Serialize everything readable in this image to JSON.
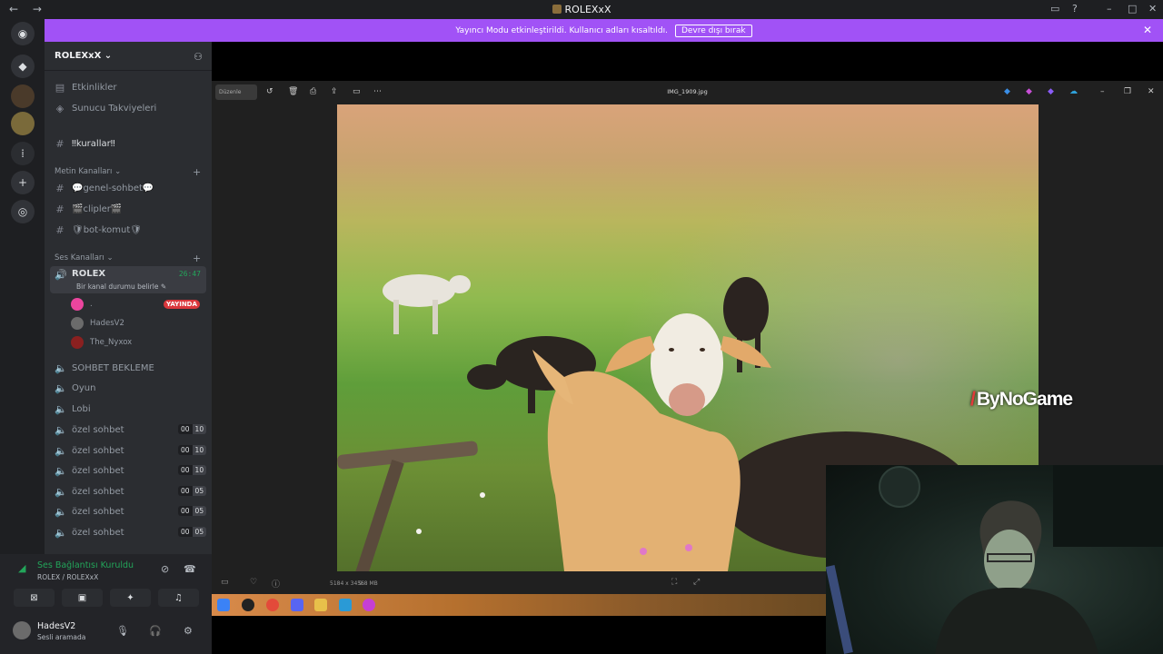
{
  "window": {
    "title": "ROLEXxX",
    "nav": "← →"
  },
  "banner": {
    "text": "Yayıncı Modu etkinleştirildi. Kullanıcı adları kısaltıldı.",
    "button": "Devre dışı bırak",
    "close": "✕"
  },
  "server": {
    "name": "ROLEXxX ⌄"
  },
  "sidebar": {
    "events": "Etkinlikler",
    "boosts": "Sunucu Takviyeleri",
    "rules_channel": "‼kurallar‼",
    "text_category": "Metin Kanalları ⌄",
    "text_channels": [
      "💬genel-sohbet💬",
      "🎬clipler🎬",
      "🛡bot-komut🛡"
    ],
    "voice_category": "Ses Kanalları ⌄",
    "active_voice": {
      "name": "ROLEX",
      "status": "Bir kanal durumu belirle ✎",
      "timer": "26:47"
    },
    "members": [
      {
        "name": ".",
        "badge": "YAYINDA"
      },
      {
        "name": "HadesV2"
      },
      {
        "name": "The_Nyxox"
      }
    ],
    "voice_channels": [
      {
        "name": "SOHBET BEKLEME"
      },
      {
        "name": "Oyun"
      },
      {
        "name": "Lobi"
      },
      {
        "name": "özel sohbet",
        "a": "00",
        "b": "10"
      },
      {
        "name": "özel sohbet",
        "a": "00",
        "b": "10"
      },
      {
        "name": "özel sohbet",
        "a": "00",
        "b": "10"
      },
      {
        "name": "özel sohbet",
        "a": "00",
        "b": "05"
      },
      {
        "name": "özel sohbet",
        "a": "00",
        "b": "05"
      },
      {
        "name": "özel sohbet",
        "a": "00",
        "b": "05"
      }
    ]
  },
  "voice_panel": {
    "status": "Ses Bağlantısı Kuruldu",
    "location": "ROLEX / ROLEXxX"
  },
  "user": {
    "name": "HadesV2",
    "status": "Sesli aramada"
  },
  "viewer": {
    "edit_label": "Düzenle",
    "filename": "IMG_1909.jpg",
    "dimensions": "5184 x 3456",
    "size": "9.8 MB"
  },
  "overlay": {
    "watermark": "ByNoGame"
  },
  "colors": {
    "accent": "#a152f6",
    "online": "#23a55a",
    "live": "#da373c"
  }
}
